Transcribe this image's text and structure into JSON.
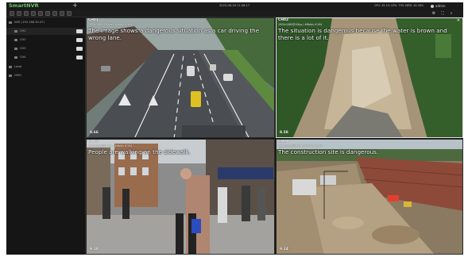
{
  "app": {
    "brand": "SmartNVR",
    "add_tab": "+",
    "datetime": "2025-06-18 11:38:17",
    "system_stats": "CPU: 35.1% GPU: 79% MEM: 44.38%",
    "user": "admin"
  },
  "sidebar": {
    "group_label": "NVR (192.168.30.47)",
    "channels": [
      {
        "label": "CH1"
      },
      {
        "label": "CH2"
      },
      {
        "label": "CH3"
      },
      {
        "label": "CH4"
      }
    ],
    "sections": [
      {
        "label": "Local"
      },
      {
        "label": "GPIO"
      }
    ]
  },
  "cameras": [
    {
      "title": "CH01",
      "info": "1920x1080@10fps | 4Mbit/s H.264",
      "caption": "The image shows a dangerous situation as a car driving the wrong lane.",
      "score": "9.66"
    },
    {
      "title": "CH02",
      "info": "1920x1080@10fps | 4Mbit/s H.264",
      "caption": "The situation is dangerous because the water is brown and there is a lot of it.",
      "score": "9.58"
    },
    {
      "title": "CH03",
      "info": "1920x1080@10fps | 4Mbit/s H.264",
      "caption": "People are walking on the sidewalk.",
      "score": "9.10"
    },
    {
      "title": "CH04",
      "info": "1920x1080@10fps | 4Mbit/s H.264",
      "caption": "The construction site is dangerous.",
      "score": "9.24"
    }
  ],
  "colors": {
    "brand_accent": "#6cc46c",
    "app_background": "#141414",
    "active_border": "#e2e2e2"
  }
}
